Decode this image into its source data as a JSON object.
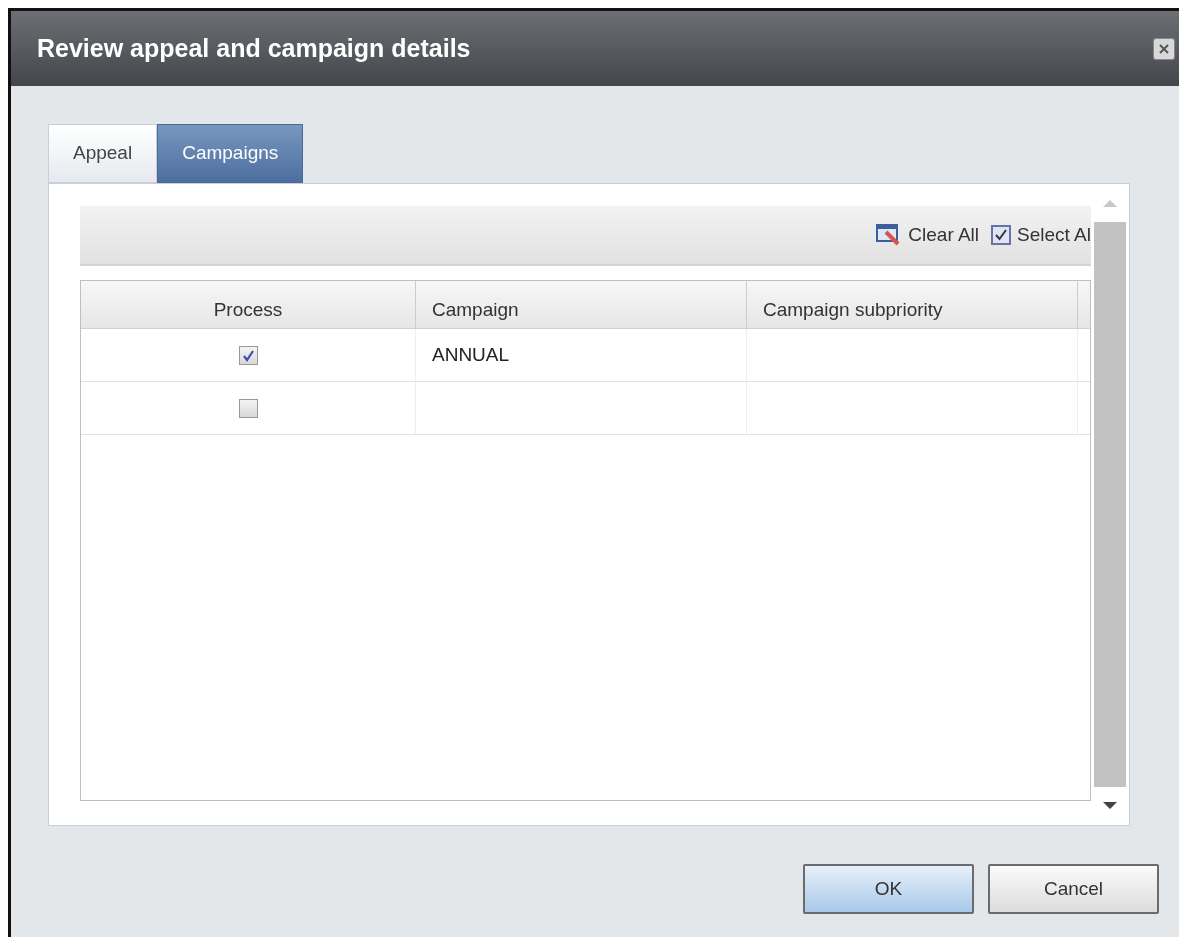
{
  "window": {
    "title": "Review appeal and campaign details"
  },
  "tabs": [
    {
      "label": "Appeal",
      "selected": false
    },
    {
      "label": "Campaigns",
      "selected": true
    }
  ],
  "toolbar": [
    {
      "kind": "clear",
      "label": "Clear All"
    },
    {
      "kind": "select",
      "label": "Select Al"
    }
  ],
  "table": {
    "columns": [
      "Process",
      "Campaign",
      "Campaign subpriority"
    ],
    "rows": [
      {
        "process_checked": true,
        "campaign": "ANNUAL"
      },
      {
        "process_checked": false
      }
    ]
  },
  "buttons": [
    {
      "label": "OK",
      "default": true
    },
    {
      "label": "Cancel",
      "default": false
    }
  ]
}
